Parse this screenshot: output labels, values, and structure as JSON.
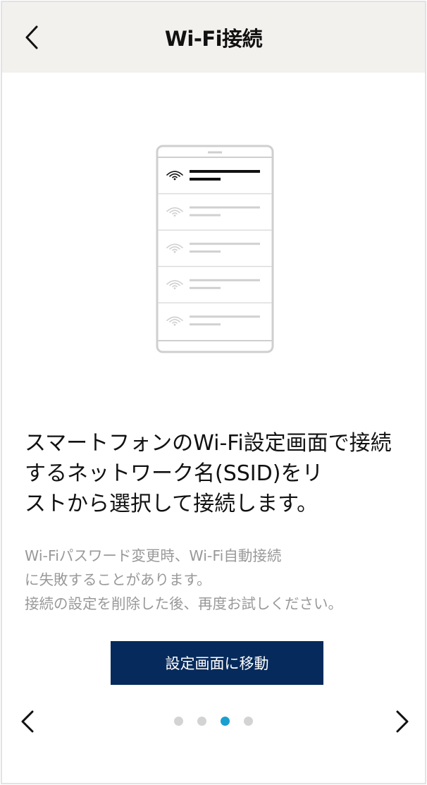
{
  "header": {
    "title": "Wi-Fi接続",
    "back_icon": "chevron-left-icon"
  },
  "illustration": {
    "description_icon": "phone-wifi-list-icon",
    "rows": [
      {
        "selected": true
      },
      {
        "selected": false
      },
      {
        "selected": false
      },
      {
        "selected": false
      },
      {
        "selected": false
      }
    ]
  },
  "main": {
    "lines": [
      "スマートフォンのWi-Fi設定画面で接続",
      "するネットワーク名(SSID)をリ",
      "ストから選択して接続します。"
    ],
    "note_lines": [
      "Wi-Fiパスワード変更時、Wi-Fi自動接続",
      "に失敗することがあります。",
      "接続の設定を削除した後、再度お試しください。"
    ],
    "button_label": "設定画面に移動"
  },
  "pager": {
    "prev_icon": "chevron-left-icon",
    "next_icon": "chevron-right-icon",
    "page_count": 4,
    "current_page": 3
  },
  "colors": {
    "header_bg": "#f3f1ee",
    "button_bg": "#062a5b",
    "dot_active": "#1a9fd0",
    "dot_inactive": "#d3d3d3",
    "note_text": "#999999"
  }
}
